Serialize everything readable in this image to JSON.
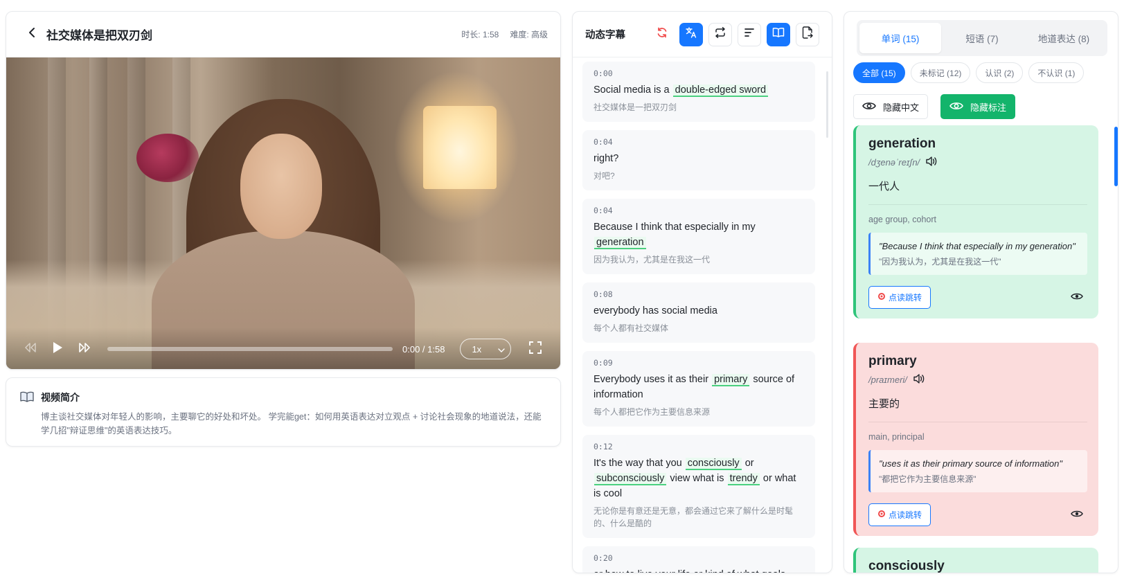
{
  "video": {
    "title": "社交媒体是把双刃剑",
    "duration": "时长: 1:58",
    "difficulty": "难度: 高级",
    "time_readout": "0:00 / 1:58",
    "speed": "1x",
    "progress_fraction": 0
  },
  "intro": {
    "title": "视频简介",
    "text": "博主谈社交媒体对年轻人的影响，主要聊它的好处和坏处。 学完能get：如何用英语表达对立观点 + 讨论社会现象的地道说法，还能学几招\"辩证思维\"的英语表达技巧。"
  },
  "subtitles": {
    "title": "动态字幕",
    "items": [
      {
        "time": "0:00",
        "en": [
          "Social media is a ",
          {
            "hl": "double-edged sword"
          }
        ],
        "zh": "社交媒体是一把双刃剑"
      },
      {
        "time": "0:04",
        "en": [
          "right?"
        ],
        "zh": "对吧?"
      },
      {
        "time": "0:04",
        "en": [
          "Because I think that especially in my ",
          {
            "hl": "generation"
          }
        ],
        "zh": "因为我认为，尤其是在我这一代"
      },
      {
        "time": "0:08",
        "en": [
          "everybody has social media"
        ],
        "zh": "每个人都有社交媒体"
      },
      {
        "time": "0:09",
        "en": [
          "Everybody uses it as their ",
          {
            "hl": "primary"
          },
          " source of information"
        ],
        "zh": "每个人都把它作为主要信息来源"
      },
      {
        "time": "0:12",
        "en": [
          "It's the way that you ",
          {
            "hl": "consciously"
          },
          " or ",
          {
            "hl": "subconsciously"
          },
          " view what is ",
          {
            "hl": "trendy"
          },
          " or what is cool"
        ],
        "zh": "无论你是有意还是无意，都会通过它来了解什么是时髦的、什么是酷的"
      },
      {
        "time": "0:20",
        "en": [
          "or how to live your life or kind of what goals"
        ],
        "zh": ""
      }
    ]
  },
  "vocab": {
    "tabs": [
      "单词 (15)",
      "短语 (7)",
      "地道表达 (8)"
    ],
    "filters": [
      "全部 (15)",
      "未标记 (12)",
      "认识 (2)",
      "不认识 (1)"
    ],
    "hide_chinese": "隐藏中文",
    "hide_marks": "隐藏标注",
    "jump_label": "点读跳转",
    "cards": [
      {
        "word": "generation",
        "phonetic": "/dʒenəˈreɪʃn/",
        "meaning": "一代人",
        "synonyms": "age group, cohort",
        "example_en": "\"Because I think that especially in my generation\"",
        "example_zh": "\"因为我认为，尤其是在我这一代\"",
        "status": "green"
      },
      {
        "word": "primary",
        "phonetic": "/praɪmeri/",
        "meaning": "主要的",
        "synonyms": "main, principal",
        "example_en": "\"uses it as their primary source of information\"",
        "example_zh": "\"都把它作为主要信息来源\"",
        "status": "red"
      },
      {
        "word": "consciously",
        "status": "green"
      }
    ]
  },
  "colors": {
    "accent": "#1677ff",
    "success": "#13b46b",
    "known": "#d6f5e5",
    "unknown": "#fbdcdc"
  }
}
